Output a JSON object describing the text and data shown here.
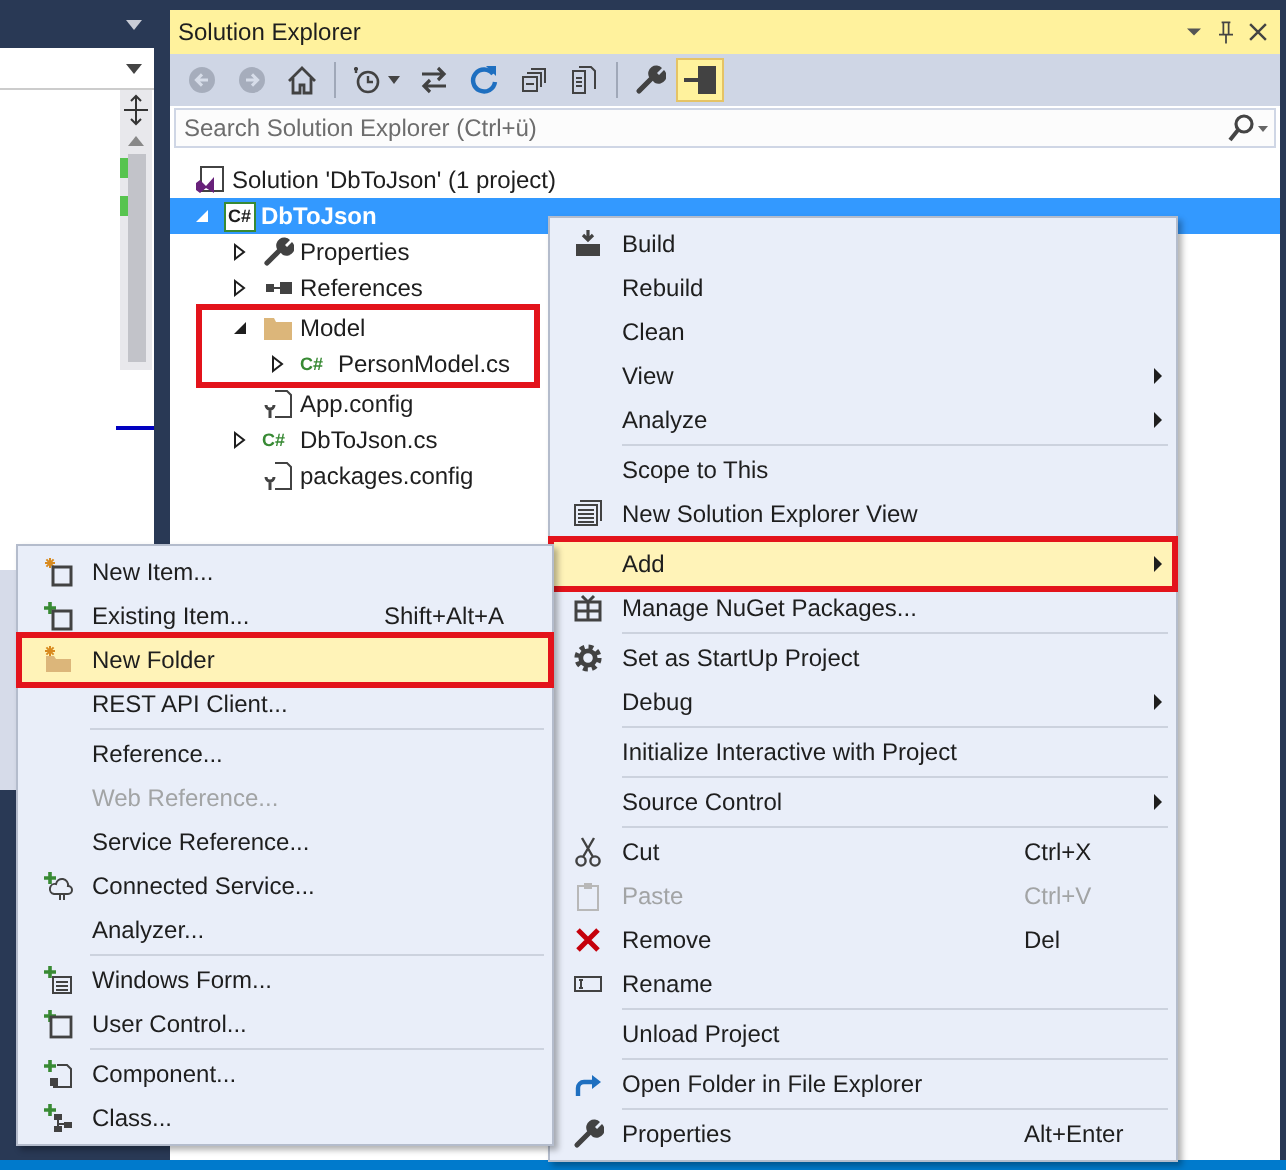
{
  "solution_explorer": {
    "title": "Solution Explorer",
    "toolbar_groups": [
      [
        {
          "disabled": true,
          "selected": false
        },
        {
          "disabled": true,
          "selected": false
        },
        {
          "disabled": false,
          "selected": false
        }
      ],
      [
        {
          "disabled": false,
          "selected": false
        },
        {
          "disabled": false,
          "selected": false
        },
        {
          "disabled": false,
          "selected": false
        },
        {
          "disabled": false,
          "selected": false
        },
        {
          "disabled": false,
          "selected": false
        }
      ],
      [
        {
          "disabled": false,
          "selected": false
        },
        {
          "disabled": false,
          "selected": true
        }
      ]
    ],
    "search": {
      "placeholder": "Search Solution Explorer (Ctrl+ü)"
    },
    "tree": {
      "items": [
        {
          "label": "Solution 'DbToJson' (1 project)",
          "selected": false,
          "children": [
            {
              "label": "DbToJson",
              "icon_text": "C#",
              "expanded": true,
              "startup": true,
              "selected": true,
              "children": [
                {
                  "label": "Properties",
                  "expanded": false,
                  "selected": false
                },
                {
                  "label": "References",
                  "expanded": false,
                  "selected": false
                },
                {
                  "label": "Model",
                  "expanded": true,
                  "selected": false,
                  "boxed": true,
                  "children": [
                    {
                      "label": "PersonModel.cs",
                      "icon_text": "C#",
                      "expanded": false,
                      "selected": false
                    }
                  ]
                },
                {
                  "label": "App.config",
                  "selected": false
                },
                {
                  "label": "DbToJson.cs",
                  "icon_text": "C#",
                  "expanded": false,
                  "selected": false
                },
                {
                  "label": "packages.config",
                  "selected": false
                }
              ]
            }
          ]
        }
      ]
    }
  },
  "context_menu": {
    "groups": [
      [
        {
          "label": "Build",
          "submenu": false,
          "disabled": false,
          "selected": false,
          "boxed": false
        },
        {
          "label": "Rebuild",
          "submenu": false,
          "disabled": false,
          "selected": false,
          "boxed": false
        },
        {
          "label": "Clean",
          "submenu": false,
          "disabled": false,
          "selected": false,
          "boxed": false
        },
        {
          "label": "View",
          "submenu": true,
          "disabled": false,
          "selected": false,
          "boxed": false
        },
        {
          "label": "Analyze",
          "submenu": true,
          "disabled": false,
          "selected": false,
          "boxed": false
        }
      ],
      [
        {
          "label": "Scope to This",
          "submenu": false,
          "disabled": false,
          "selected": false,
          "boxed": false
        },
        {
          "label": "New Solution Explorer View",
          "submenu": false,
          "disabled": false,
          "selected": false,
          "boxed": false
        }
      ],
      [
        {
          "label": "Add",
          "submenu": true,
          "disabled": false,
          "selected": true,
          "boxed": true
        },
        {
          "label": "Manage NuGet Packages...",
          "submenu": false,
          "disabled": false,
          "selected": false,
          "boxed": false
        }
      ],
      [
        {
          "label": "Set as StartUp Project",
          "submenu": false,
          "disabled": false,
          "selected": false,
          "boxed": false
        },
        {
          "label": "Debug",
          "submenu": true,
          "disabled": false,
          "selected": false,
          "boxed": false
        }
      ],
      [
        {
          "label": "Initialize Interactive with Project",
          "submenu": false,
          "disabled": false,
          "selected": false,
          "boxed": false
        }
      ],
      [
        {
          "label": "Source Control",
          "submenu": true,
          "disabled": false,
          "selected": false,
          "boxed": false
        }
      ],
      [
        {
          "label": "Cut",
          "shortcut": "Ctrl+X",
          "submenu": false,
          "disabled": false,
          "selected": false,
          "boxed": false
        },
        {
          "label": "Paste",
          "shortcut": "Ctrl+V",
          "submenu": false,
          "disabled": true,
          "selected": false,
          "boxed": false
        },
        {
          "label": "Remove",
          "shortcut": "Del",
          "submenu": false,
          "disabled": false,
          "selected": false,
          "boxed": false
        },
        {
          "label": "Rename",
          "submenu": false,
          "disabled": false,
          "selected": false,
          "boxed": false
        }
      ],
      [
        {
          "label": "Unload Project",
          "submenu": false,
          "disabled": false,
          "selected": false,
          "boxed": false
        }
      ],
      [
        {
          "label": "Open Folder in File Explorer",
          "submenu": false,
          "disabled": false,
          "selected": false,
          "boxed": false
        }
      ],
      [
        {
          "label": "Properties",
          "shortcut": "Alt+Enter",
          "submenu": false,
          "disabled": false,
          "selected": false,
          "boxed": false
        }
      ]
    ]
  },
  "add_submenu": {
    "groups": [
      [
        {
          "label": "New Item...",
          "submenu": false,
          "disabled": false,
          "selected": false,
          "boxed": false
        },
        {
          "label": "Existing Item...",
          "shortcut": "Shift+Alt+A",
          "submenu": false,
          "disabled": false,
          "selected": false,
          "boxed": false
        },
        {
          "label": "New Folder",
          "submenu": false,
          "disabled": false,
          "selected": true,
          "boxed": true
        },
        {
          "label": "REST API Client...",
          "submenu": false,
          "disabled": false,
          "selected": false,
          "boxed": false
        }
      ],
      [
        {
          "label": "Reference...",
          "submenu": false,
          "disabled": false,
          "selected": false,
          "boxed": false
        },
        {
          "label": "Web Reference...",
          "submenu": false,
          "disabled": true,
          "selected": false,
          "boxed": false
        },
        {
          "label": "Service Reference...",
          "submenu": false,
          "disabled": false,
          "selected": false,
          "boxed": false
        },
        {
          "label": "Connected Service...",
          "submenu": false,
          "disabled": false,
          "selected": false,
          "boxed": false
        },
        {
          "label": "Analyzer...",
          "submenu": false,
          "disabled": false,
          "selected": false,
          "boxed": false
        }
      ],
      [
        {
          "label": "Windows Form...",
          "submenu": false,
          "disabled": false,
          "selected": false,
          "boxed": false
        },
        {
          "label": "User Control...",
          "submenu": false,
          "disabled": false,
          "selected": false,
          "boxed": false
        }
      ],
      [
        {
          "label": "Component...",
          "submenu": false,
          "disabled": false,
          "selected": false,
          "boxed": false
        },
        {
          "label": "Class...",
          "submenu": false,
          "disabled": false,
          "selected": false,
          "boxed": false
        }
      ]
    ]
  }
}
